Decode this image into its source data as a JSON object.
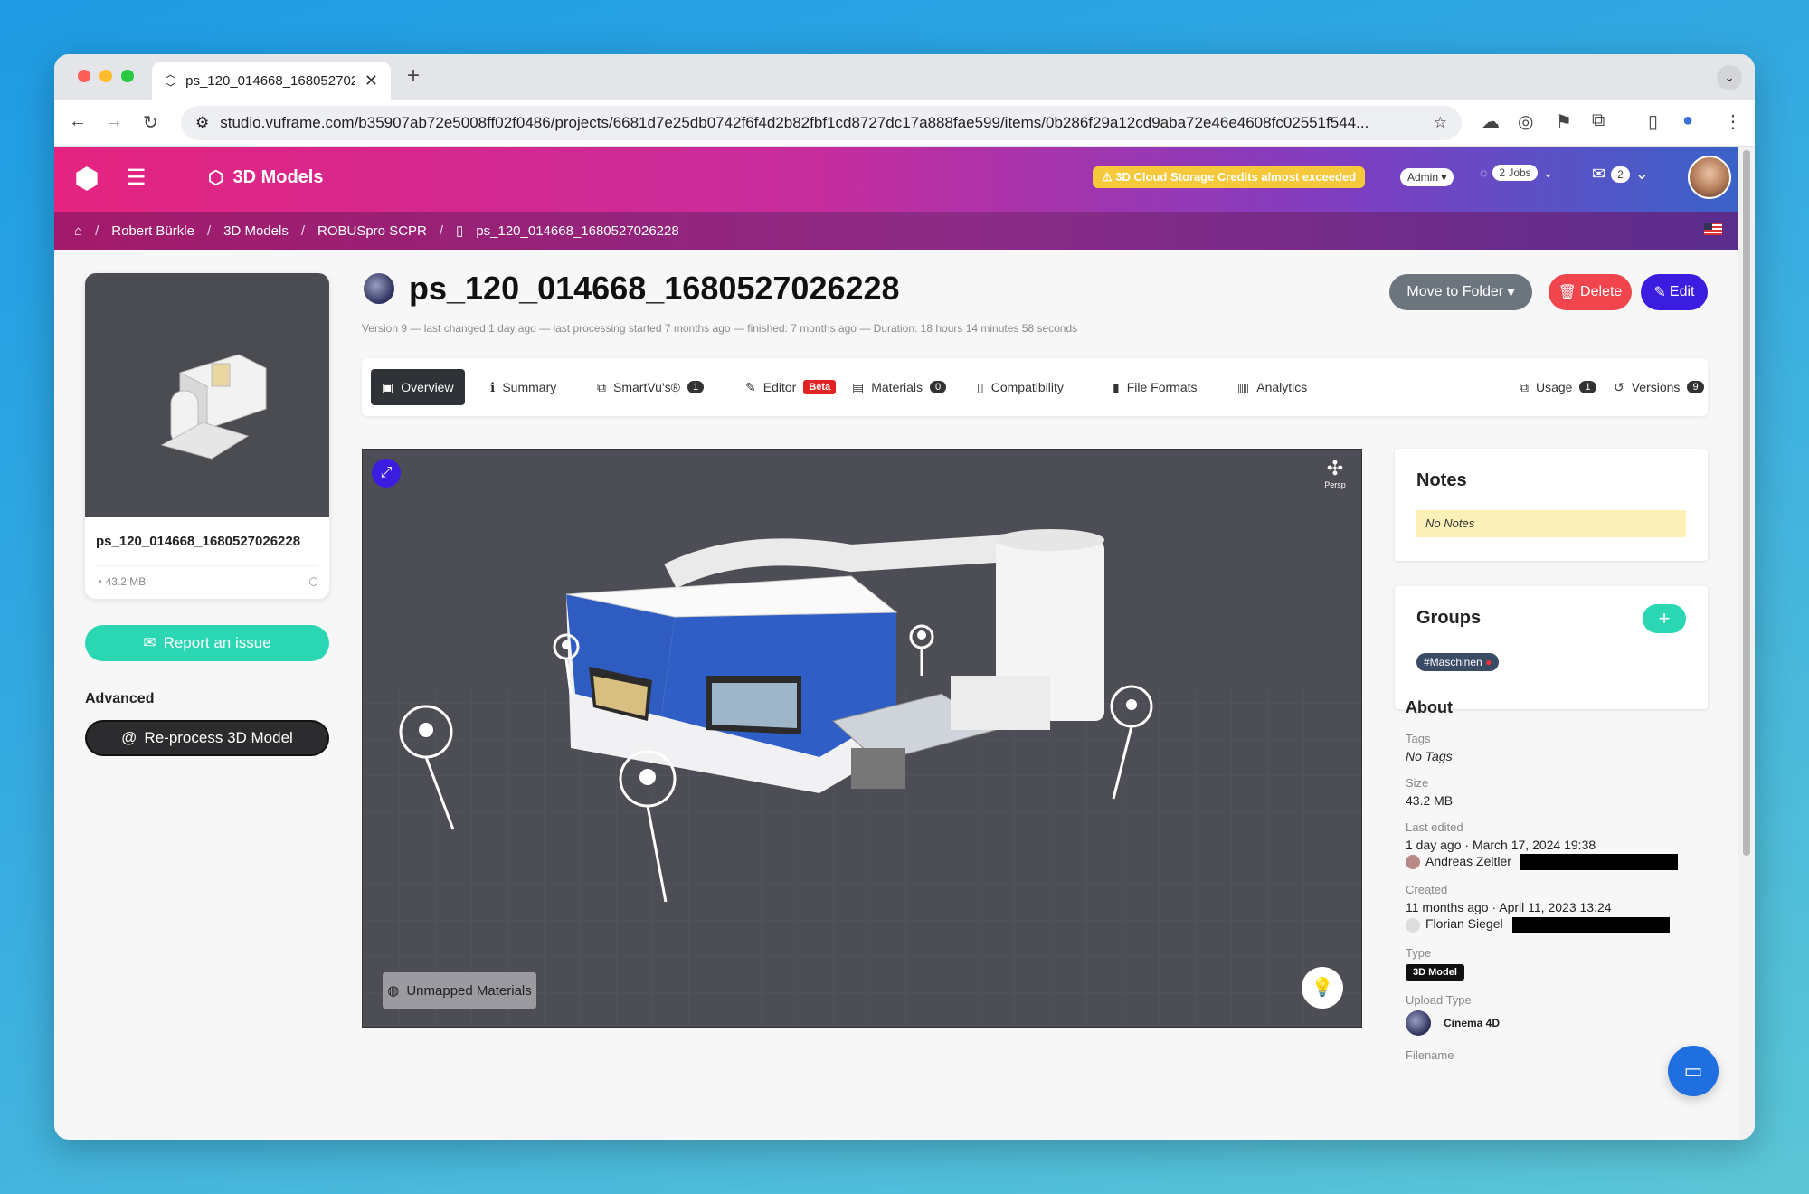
{
  "browser": {
    "tab_title": "ps_120_014668_168052702\"",
    "url": "studio.vuframe.com/b35907ab72e5008ff02f0486/projects/6681d7e25db0742f6f4d2b82fbf1cd8727dc17a888fae599/items/0b286f29a12cd9aba72e46e4608fc02551f544..."
  },
  "header": {
    "app_name": "3D Models",
    "warning": "3D Cloud Storage Credits almost exceeded",
    "admin": "Admin",
    "jobs": "2 Jobs",
    "messages": "2"
  },
  "breadcrumb": [
    "Robert Bürkle",
    "3D Models",
    "ROBUSpro SCPR",
    "ps_120_014668_1680527026228"
  ],
  "left": {
    "card_title": "ps_120_014668_1680527026228",
    "card_size": "43.2 MB",
    "report_label": "Report an issue",
    "advanced_label": "Advanced",
    "reprocess_label": "Re-process 3D Model"
  },
  "main": {
    "title": "ps_120_014668_1680527026228",
    "subtitle": "Version 9 — last changed 1 day ago — last processing started 7 months ago — finished: 7 months ago — Duration: 18 hours 14 minutes 58 seconds",
    "move_label": "Move to Folder",
    "delete_label": "Delete",
    "edit_label": "Edit",
    "tabs": [
      {
        "label": "Overview"
      },
      {
        "label": "Summary"
      },
      {
        "label": "SmartVu's®",
        "count": "1"
      },
      {
        "label": "Editor",
        "badge": "Beta"
      },
      {
        "label": "Materials",
        "count": "0"
      },
      {
        "label": "Compatibility"
      },
      {
        "label": "File Formats"
      },
      {
        "label": "Analytics"
      },
      {
        "label": "Usage",
        "count": "1"
      },
      {
        "label": "Versions",
        "count": "9"
      }
    ]
  },
  "viewer": {
    "gizmo_label": "Persp",
    "unmapped_label": "Unmapped Materials"
  },
  "notes": {
    "title": "Notes",
    "empty": "No Notes"
  },
  "groups": {
    "title": "Groups",
    "tag": "#Maschinen"
  },
  "about": {
    "title": "About",
    "tags_label": "Tags",
    "tags_value": "No Tags",
    "size_label": "Size",
    "size_value": "43.2 MB",
    "edited_label": "Last edited",
    "edited_value": "1 day ago · March 17, 2024 19:38",
    "edited_by": "Andreas Zeitler",
    "created_label": "Created",
    "created_value": "11 months ago · April 11, 2023 13:24",
    "created_by": "Florian Siegel",
    "type_label": "Type",
    "type_value": "3D Model",
    "upload_label": "Upload Type",
    "upload_value": "Cinema 4D",
    "filename_label": "Filename"
  },
  "colors": {
    "accent": "#3b1de0",
    "teal": "#2bd6b3",
    "danger": "#f0454d"
  }
}
